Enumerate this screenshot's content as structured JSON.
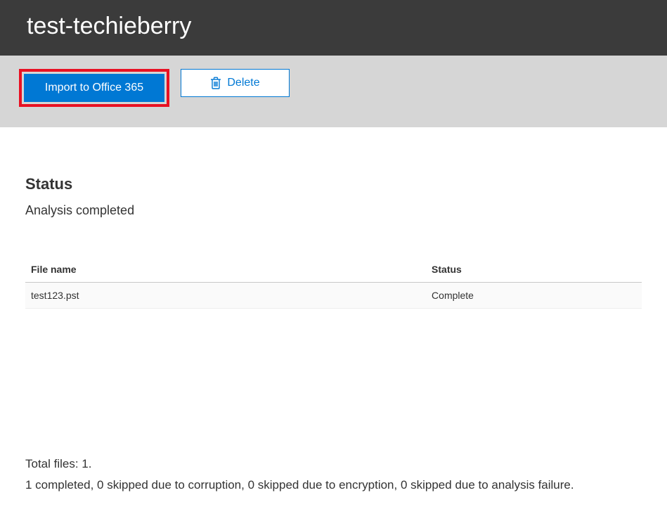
{
  "header": {
    "title": "test-techieberry"
  },
  "toolbar": {
    "import_label": "Import to Office 365",
    "delete_label": "Delete"
  },
  "status": {
    "heading": "Status",
    "message": "Analysis completed"
  },
  "table": {
    "headers": {
      "filename": "File name",
      "status": "Status"
    },
    "rows": [
      {
        "filename": "test123.pst",
        "status": "Complete"
      }
    ]
  },
  "summary": {
    "total_line": "Total files: 1.",
    "detail_line": "1 completed, 0 skipped due to corruption, 0 skipped due to encryption, 0 skipped due to analysis failure."
  },
  "colors": {
    "primary": "#0078d4",
    "highlight": "#e81123",
    "header_bg": "#3b3b3b",
    "toolbar_bg": "#d6d6d6"
  }
}
